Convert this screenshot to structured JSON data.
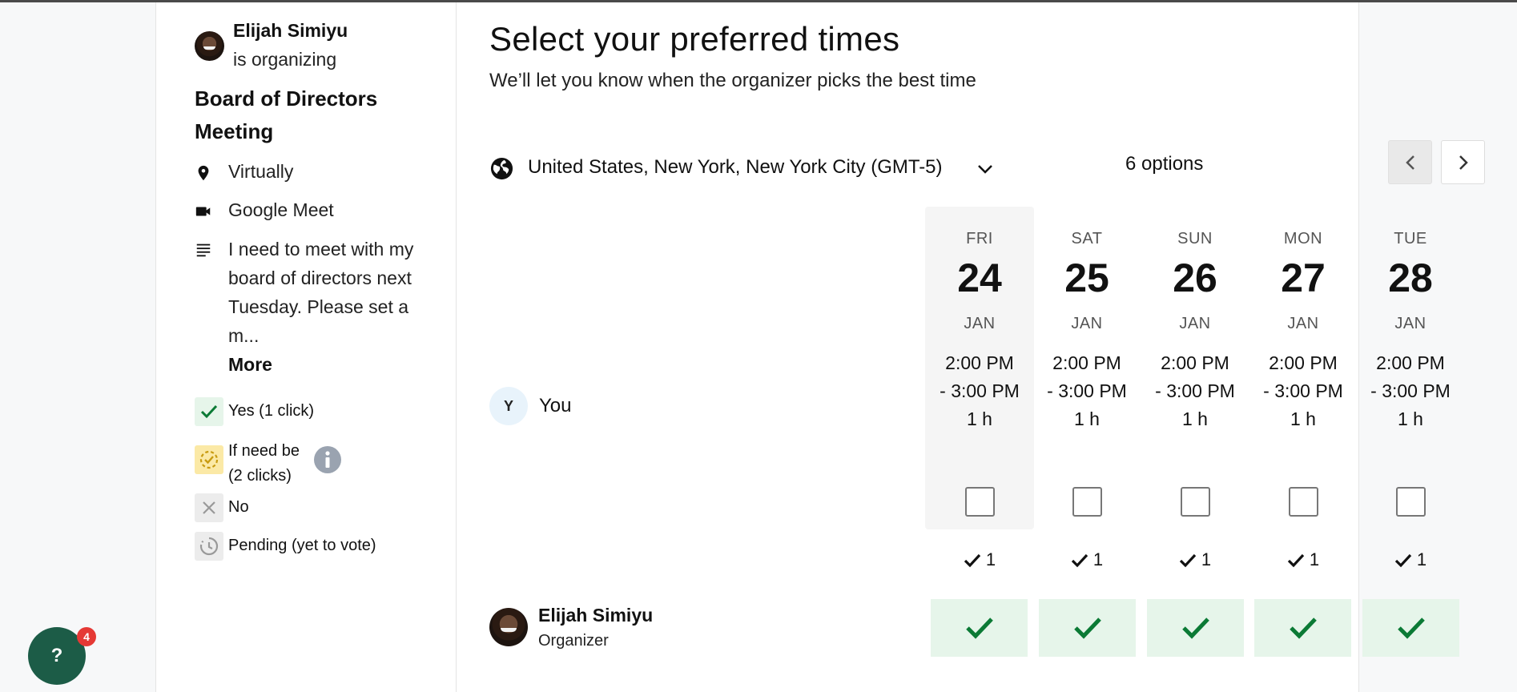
{
  "organizer": {
    "name": "Elijah Simiyu",
    "status": "is organizing",
    "role": "Organizer"
  },
  "event": {
    "title": "Board of Directors Meeting",
    "location": "Virtually",
    "conferencing": "Google Meet",
    "description": "I need to meet with my board of directors next Tuesday. Please set a m...",
    "more_label": "More"
  },
  "legend": {
    "yes": "Yes (1 click)",
    "if_need_be": "If need be (2 clicks)",
    "no": "No",
    "pending": "Pending (yet to vote)"
  },
  "main": {
    "title": "Select your preferred times",
    "subtitle": "We’ll let you know when the organizer picks the best time",
    "timezone": "United States, New York, New York City (GMT-5)",
    "options_count": "6 options"
  },
  "you": {
    "initial": "Y",
    "label": "You"
  },
  "columns": [
    {
      "dow": "FRI",
      "day": "24",
      "month": "JAN",
      "start": "2:00 PM",
      "end": "- 3:00 PM",
      "duration": "1 h",
      "count": "1"
    },
    {
      "dow": "SAT",
      "day": "25",
      "month": "JAN",
      "start": "2:00 PM",
      "end": "- 3:00 PM",
      "duration": "1 h",
      "count": "1"
    },
    {
      "dow": "SUN",
      "day": "26",
      "month": "JAN",
      "start": "2:00 PM",
      "end": "- 3:00 PM",
      "duration": "1 h",
      "count": "1"
    },
    {
      "dow": "MON",
      "day": "27",
      "month": "JAN",
      "start": "2:00 PM",
      "end": "- 3:00 PM",
      "duration": "1 h",
      "count": "1"
    },
    {
      "dow": "TUE",
      "day": "28",
      "month": "JAN",
      "start": "2:00 PM",
      "end": "- 3:00 PM",
      "duration": "1 h",
      "count": "1"
    }
  ],
  "help": {
    "label": "?",
    "badge": "4"
  },
  "colors": {
    "accent_green": "#0b7a35",
    "vote_bg": "#e6f5ea",
    "help_bg": "#1c5c47",
    "badge_red": "#e53935"
  }
}
